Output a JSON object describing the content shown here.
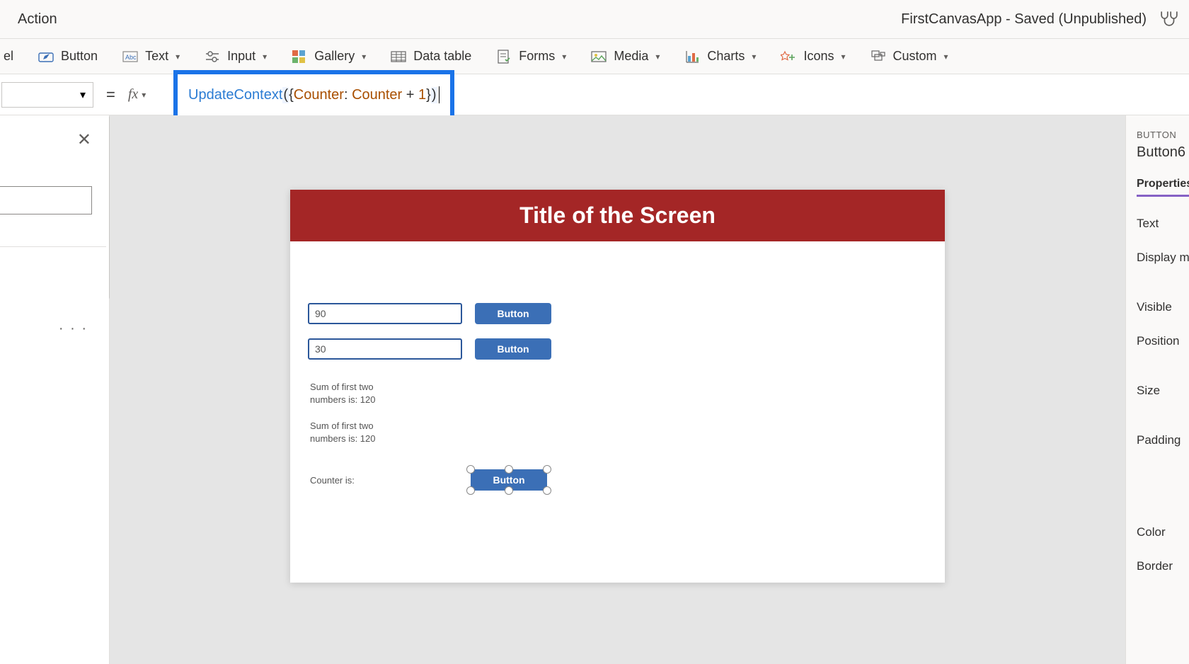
{
  "top": {
    "action": "Action",
    "title_status": "FirstCanvasApp - Saved (Unpublished)"
  },
  "ribbon": {
    "label_partial": "el",
    "button": "Button",
    "text": "Text",
    "input": "Input",
    "gallery": "Gallery",
    "data_table": "Data table",
    "forms": "Forms",
    "media": "Media",
    "charts": "Charts",
    "icons": "Icons",
    "custom": "Custom"
  },
  "formula": {
    "equals": "=",
    "fx": "fx",
    "tokens": {
      "fn": "UpdateContext",
      "open_paren": "(",
      "open_brace": "{",
      "key": "Counter",
      "colon": ":",
      "ref": "Counter",
      "plus": "+",
      "num": "1",
      "close_brace": "}",
      "close_paren": ")"
    }
  },
  "left": {
    "dots": "· · ·"
  },
  "canvas": {
    "screen_title": "Title of the Screen",
    "input1_value": "90",
    "input2_value": "30",
    "btn_label": "Button",
    "result1": "Sum of first two numbers is: 120",
    "result2": "Sum of first two numbers is: 120",
    "counter_label": "Counter is:"
  },
  "right": {
    "kind": "BUTTON",
    "name": "Button6",
    "tab": "Properties",
    "props": {
      "text": "Text",
      "display_mode": "Display mod",
      "visible": "Visible",
      "position": "Position",
      "size": "Size",
      "padding": "Padding",
      "color": "Color",
      "border": "Border"
    }
  }
}
